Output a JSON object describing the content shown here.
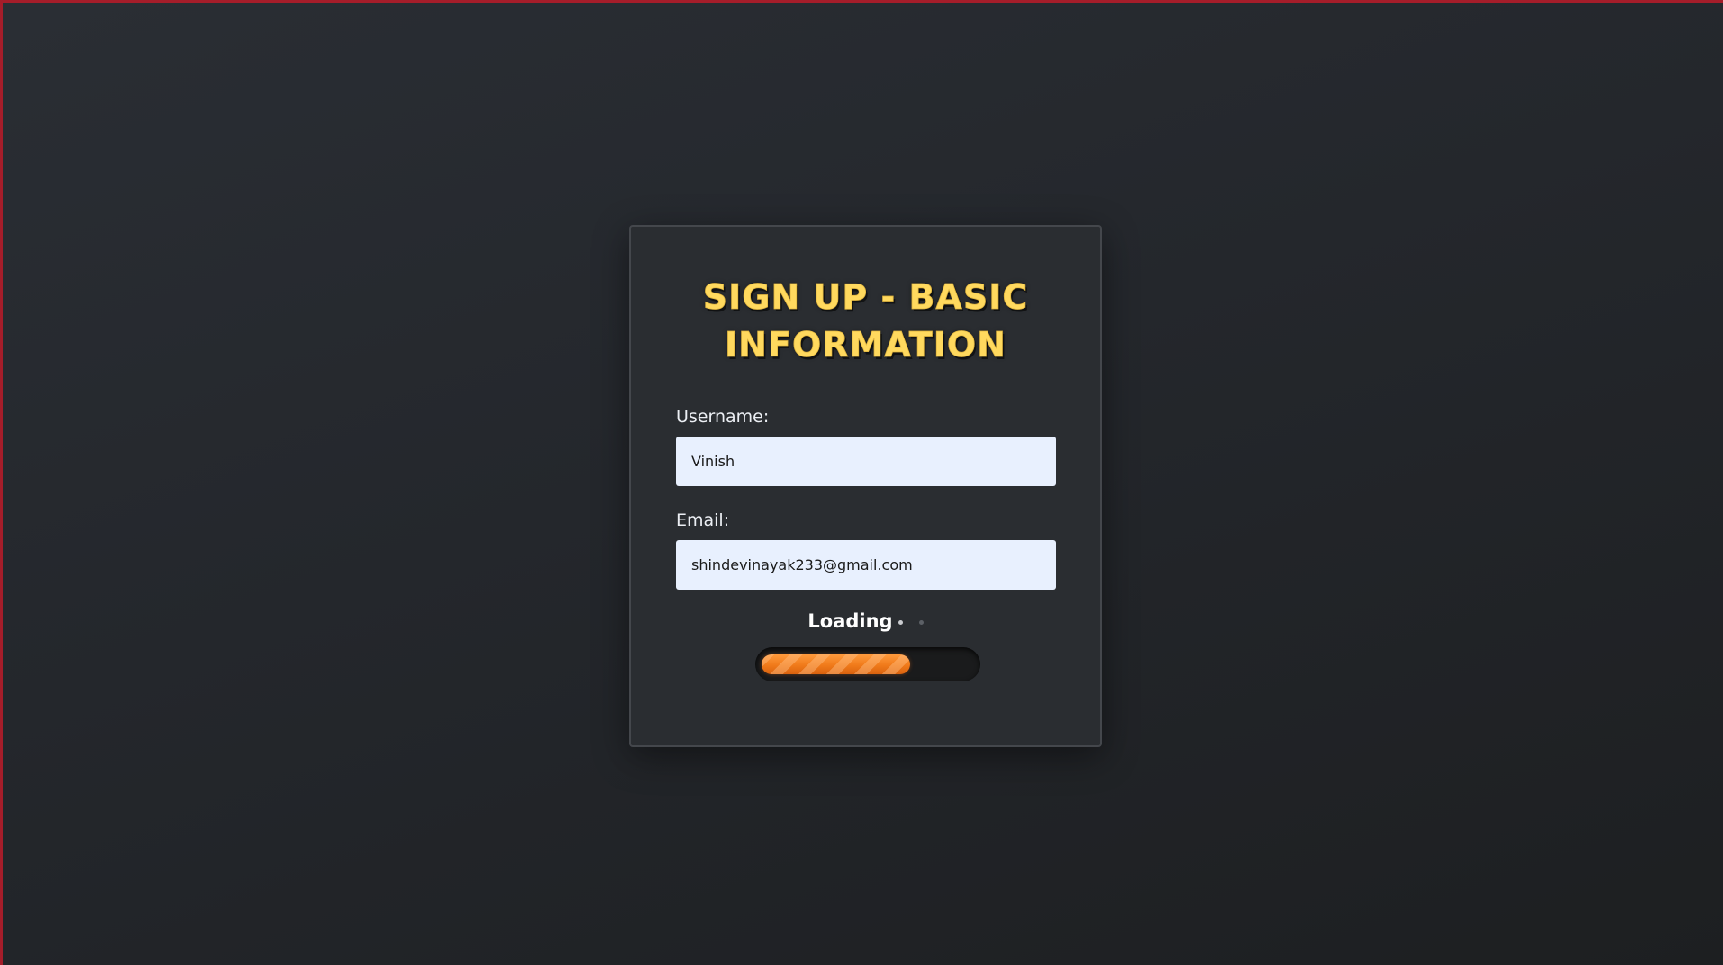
{
  "form": {
    "title": "Sign Up - Basic Information",
    "username_label": "Username:",
    "username_value": "Vinish",
    "email_label": "Email:",
    "email_value": "shindevinayak233@gmail.com"
  },
  "loading": {
    "text": "Loading",
    "progress": 0.7
  },
  "colors": {
    "title": "#ffd95e",
    "progress": "#f07a1a",
    "background": "#24272c",
    "frame_border": "#a51d2a"
  }
}
